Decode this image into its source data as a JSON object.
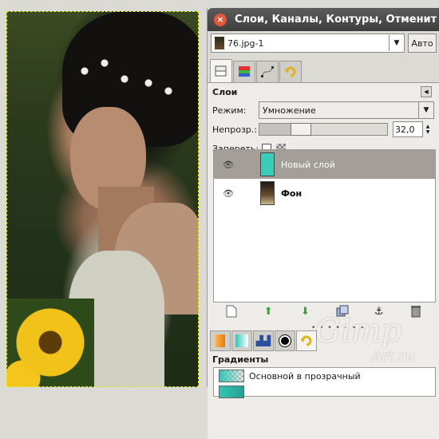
{
  "window": {
    "title": "Слои, Каналы, Контуры, Отменит",
    "close_glyph": "×"
  },
  "image_selector": {
    "value": "76.jpg-1",
    "auto_label": "Авто"
  },
  "tabs": [
    {
      "icon": "layers-icon",
      "active": true
    },
    {
      "icon": "channels-icon"
    },
    {
      "icon": "paths-icon"
    },
    {
      "icon": "undo-history-icon"
    }
  ],
  "layers_panel": {
    "title": "Слои",
    "mode_label": "Режим:",
    "mode_value": "Умножение",
    "opacity_label": "Непрозр.:",
    "opacity_value": "32,0",
    "opacity_level": 0.32,
    "lock_label": "Запереть:",
    "layers": [
      {
        "name": "Новый слой",
        "selected": true,
        "thumb": "cyan"
      },
      {
        "name": "Фон",
        "selected": false,
        "thumb": "photo"
      }
    ]
  },
  "bottom_tabs": [
    {
      "icon": "pattern-icon"
    },
    {
      "icon": "gradient-icon"
    },
    {
      "icon": "brush-icon"
    },
    {
      "icon": "brush-dot-icon"
    },
    {
      "icon": "undo-icon",
      "active": true
    }
  ],
  "gradients_panel": {
    "title": "Градиенты",
    "items": [
      "Основной в прозрачный",
      ""
    ]
  },
  "watermark": {
    "main": "Gimp",
    "sub": "Art.ru"
  },
  "colors": {
    "accent_cyan": "#3ccbb8",
    "title_bar": "#3e3e3e",
    "close_button": "#e0573a",
    "selection": "#a39f98"
  }
}
